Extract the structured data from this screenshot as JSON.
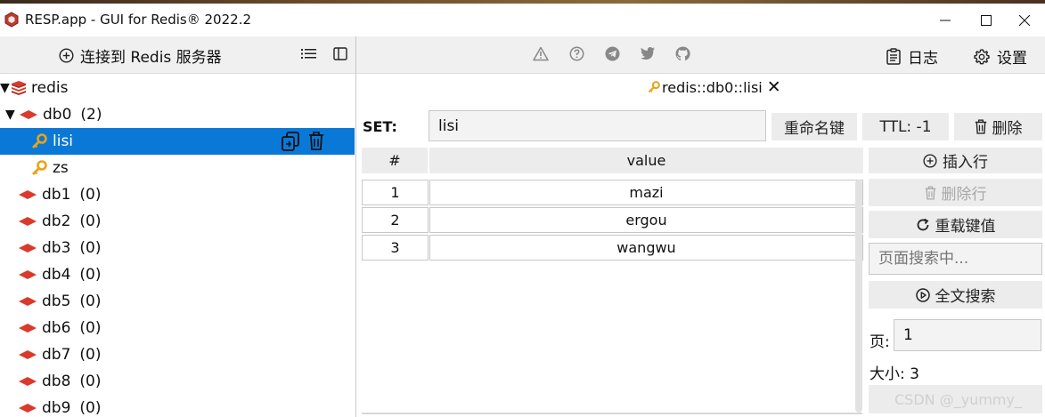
{
  "window": {
    "title": "RESP.app - GUI for Redis® 2022.2"
  },
  "left_panel": {
    "connect_label": "连接到 Redis 服务器",
    "tree": {
      "server": "redis",
      "databases": [
        {
          "name": "db0",
          "count": "(2)",
          "expanded": true
        },
        {
          "name": "db1",
          "count": "(0)"
        },
        {
          "name": "db2",
          "count": "(0)"
        },
        {
          "name": "db3",
          "count": "(0)"
        },
        {
          "name": "db4",
          "count": "(0)"
        },
        {
          "name": "db5",
          "count": "(0)"
        },
        {
          "name": "db6",
          "count": "(0)"
        },
        {
          "name": "db7",
          "count": "(0)"
        },
        {
          "name": "db8",
          "count": "(0)"
        },
        {
          "name": "db9",
          "count": "(0)"
        }
      ],
      "keys": [
        {
          "name": "lisi",
          "selected": true
        },
        {
          "name": "zs",
          "selected": false
        }
      ]
    }
  },
  "toolbar": {
    "log_label": "日志",
    "settings_label": "设置",
    "icons": [
      "warning-icon",
      "help-icon",
      "telegram-icon",
      "twitter-icon",
      "github-icon"
    ]
  },
  "tab": {
    "label": "redis::db0::lisi"
  },
  "key_editor": {
    "type_label": "SET:",
    "key_name": "lisi",
    "rename_label": "重命名键",
    "ttl_label": "TTL:  -1",
    "delete_label": "删除"
  },
  "table": {
    "headers": [
      "#",
      "value"
    ],
    "rows": [
      {
        "index": "1",
        "value": "mazi"
      },
      {
        "index": "2",
        "value": "ergou"
      },
      {
        "index": "3",
        "value": "wangwu"
      }
    ]
  },
  "side_actions": {
    "insert_row": "插入行",
    "delete_row": "删除行",
    "reload": "重载键值",
    "search_placeholder": "页面搜索中...",
    "fulltext_search": "全文搜索",
    "page_label": "页:",
    "page_value": "1",
    "size_text": "大小:  3"
  },
  "watermark": "CSDN @_yummy_",
  "colors": {
    "selection": "#0a78d7",
    "redis_red": "#d93a2b",
    "key_orange": "#e8a317"
  }
}
